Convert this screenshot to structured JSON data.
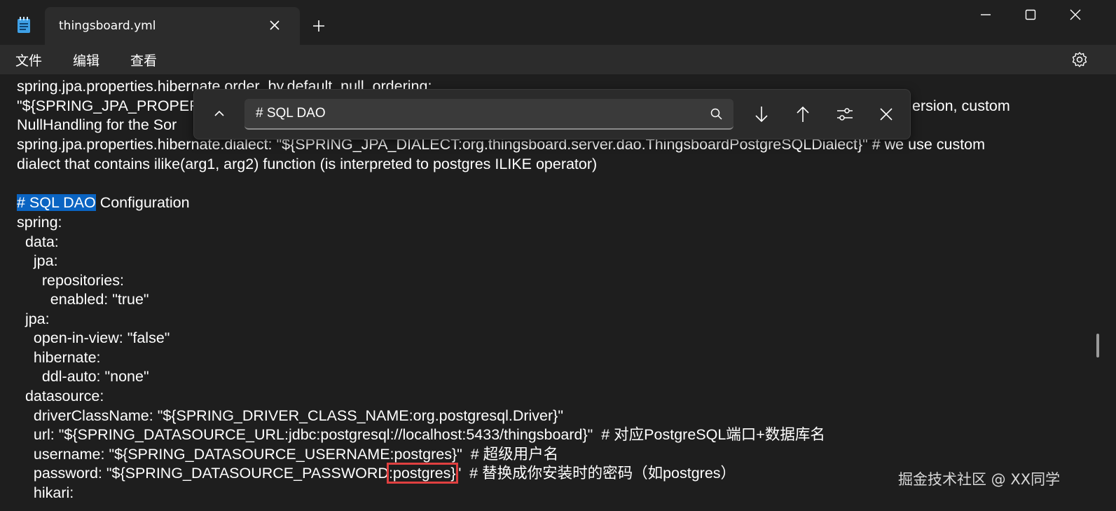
{
  "tab": {
    "title": "thingsboard.yml"
  },
  "menu": {
    "file": "文件",
    "edit": "编辑",
    "view": "查看"
  },
  "find": {
    "query": "# SQL DAO"
  },
  "editor": {
    "lines": [
      "spring.jpa.properties.hibernate.order_by.default_null_ordering:",
      "\"${SPRING_JPA_PROPERT",
      "ersion, custom",
      "NullHandling for the Sor",
      "spring.jpa.properties.hibernate.dialect: \"${SPRING_JPA_DIALECT:org.thingsboard.server.dao.ThingsboardPostgreSQLDialect}\" # we use custom",
      "dialect that contains ilike(arg1, arg2) function (is interpreted to postgres ILIKE operator)",
      "",
      " Configuration",
      "spring:",
      "  data:",
      "    jpa:",
      "      repositories:",
      "        enabled: \"true\"",
      "  jpa:",
      "    open-in-view: \"false\"",
      "    hibernate:",
      "      ddl-auto: \"none\"",
      "  datasource:",
      "    driverClassName: \"${SPRING_DRIVER_CLASS_NAME:org.postgresql.Driver}\"",
      "    url: \"${SPRING_DATASOURCE_URL:jdbc:postgresql://localhost:5433/thingsboard}\"  # 对应PostgreSQL端口+数据库名",
      "    username: \"${SPRING_DATASOURCE_USERNAME:postgres}\"  # 超级用户名",
      "    password: \"${SPRING_DATASOURCE_PASSWORD",
      ":postgres}",
      "\"  # 替换成你安装时的密码（如postgres）",
      "    hikari:"
    ],
    "highlight_match": "# SQL DAO"
  },
  "watermark": "掘金技术社区 @ XX同学",
  "colors": {
    "background": "#1e1e1e",
    "selection": "#0a64c2",
    "annotation_box": "#e04040"
  }
}
